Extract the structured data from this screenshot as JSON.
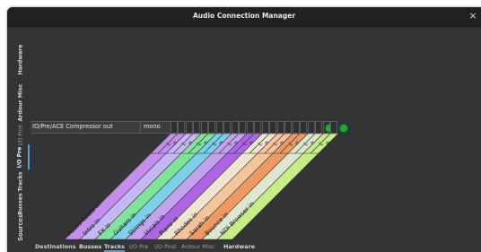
{
  "window": {
    "title": "Audio Connection Manager",
    "close_glyph": "×"
  },
  "left_tabs": {
    "header": "Sources",
    "items": [
      {
        "label": "Busses",
        "style": "bold"
      },
      {
        "label": "Tracks",
        "style": "bold"
      },
      {
        "label": "I/O Pre",
        "style": "active"
      },
      {
        "label": "I/O Post",
        "style": "dim"
      },
      {
        "label": "Ardour Misc",
        "style": "bold"
      },
      {
        "label": "Hardware",
        "style": "bold"
      }
    ]
  },
  "bottom_tabs": {
    "header": "Destinations",
    "items": [
      {
        "label": "Busses",
        "style": "bold"
      },
      {
        "label": "Tracks",
        "style": "active"
      },
      {
        "label": "I/O Pre",
        "style": "dim"
      },
      {
        "label": "I/O Post",
        "style": "dim"
      },
      {
        "label": "Ardour Misc",
        "style": "dim"
      },
      {
        "label": "Hardware",
        "style": "bold"
      }
    ]
  },
  "source_port": {
    "name": "IO/Pre/ACE Compressor out",
    "channel": "mono"
  },
  "destination_tracks": [
    {
      "name": "Audio Beats in",
      "color": "#c38ef0",
      "channels": [
        "L",
        "R"
      ]
    },
    {
      "name": "Intro in",
      "color": "#c3b8ef",
      "channels": [
        "L",
        "R"
      ]
    },
    {
      "name": "FX in",
      "color": "#7fe49a",
      "channels": [
        "L",
        "R"
      ]
    },
    {
      "name": "Guitars in",
      "color": "#7ecfea",
      "channels": [
        "L",
        "R"
      ]
    },
    {
      "name": "Strings in",
      "color": "#c4a2ee",
      "channels": [
        "L",
        "R"
      ]
    },
    {
      "name": "Vocals in",
      "color": "#ad66e4",
      "channels": [
        "L",
        "R"
      ]
    },
    {
      "name": "Piano in",
      "color": "#efe4cf",
      "channels": [
        "L",
        "R"
      ]
    },
    {
      "name": "Rhodes in",
      "color": "#f6c39a",
      "channels": [
        "L",
        "R"
      ]
    },
    {
      "name": "Sarah in",
      "color": "#f09a62",
      "channels": [
        "L",
        "R"
      ]
    },
    {
      "name": "Bounce in",
      "color": "#dbe7d1",
      "channels": [
        "L",
        "R"
      ]
    },
    {
      "name": "NDI Browser in",
      "color": "#c6ec84",
      "channels": [
        "L",
        "R"
      ]
    }
  ],
  "connections": [
    {
      "track": "NDI Browser in",
      "channel": "L",
      "connected": true
    },
    {
      "track": "NDI Browser in",
      "channel": "R",
      "connected": true
    }
  ]
}
